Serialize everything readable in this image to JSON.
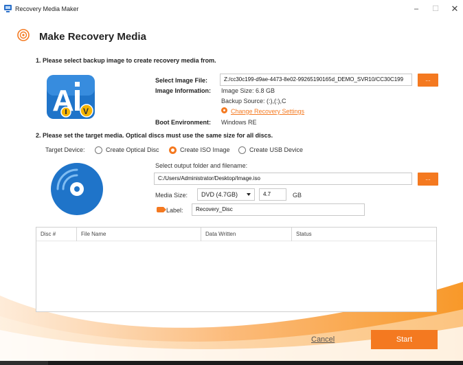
{
  "window": {
    "title": "Recovery Media Maker",
    "minimize_glyph": "–",
    "maximize_glyph": "☐",
    "close_glyph": "✕"
  },
  "header": {
    "title": "Make Recovery Media"
  },
  "section1": {
    "heading": "1. Please select backup image to create recovery media from.",
    "select_image_label": "Select Image File:",
    "image_file_value": "Z:/cc30c199-d9ae-4473-8e02-99265190165d_DEMO_SVR10/CC30C199",
    "browse_label": "...",
    "image_info_label": "Image Information:",
    "image_size": "Image Size:  6.8 GB",
    "backup_source": "Backup Source:  (:),(:),C",
    "change_settings_link": "Change Recovery Settings",
    "boot_env_label": "Boot Environment:",
    "boot_env_value": "Windows RE"
  },
  "section2": {
    "heading": "2. Please set the target media. Optical discs must use the same size for all discs.",
    "target_device_label": "Target Device:",
    "options": [
      {
        "label": "Create Optical Disc",
        "checked": false
      },
      {
        "label": "Create ISO Image",
        "checked": true
      },
      {
        "label": "Create USB Device",
        "checked": false
      }
    ],
    "output_label": "Select output folder and filename:",
    "output_value": "C:/Users/Administrator/Desktop/Image.iso",
    "browse_label": "...",
    "media_size_label": "Media Size:",
    "media_size_selected": "DVD (4.7GB)",
    "media_size_value": "4.7",
    "media_size_unit": "GB",
    "label_label": "Label:",
    "label_value": "Recovery_Disc"
  },
  "table": {
    "columns": [
      "Disc #",
      "File Name",
      "Data Written",
      "Status"
    ]
  },
  "footer": {
    "cancel_label": "Cancel",
    "start_label": "Start"
  },
  "colors": {
    "accent": "#f47920",
    "logo_blue": "#1f74c9"
  }
}
